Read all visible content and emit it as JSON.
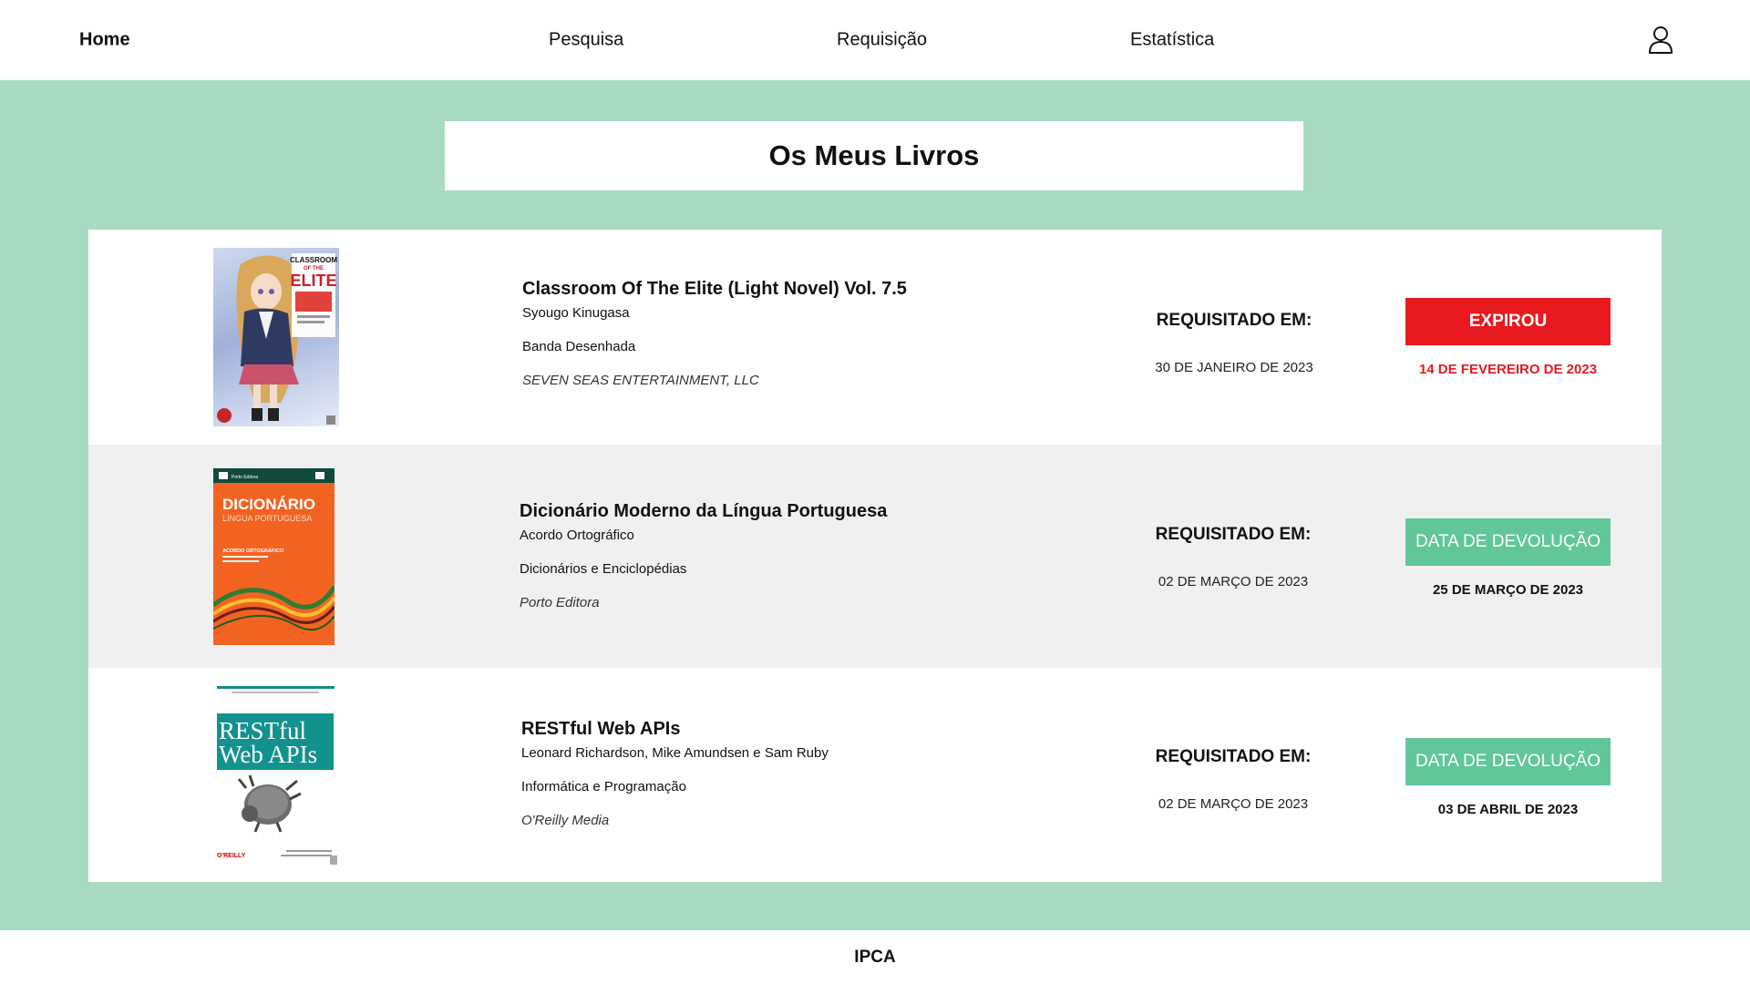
{
  "nav": {
    "home": "Home",
    "pesquisa": "Pesquisa",
    "requisicao": "Requisição",
    "estatistica": "Estatística",
    "user_icon": "user-icon"
  },
  "page": {
    "title": "Os Meus Livros"
  },
  "books": [
    {
      "title": "Classroom Of The Elite (Light Novel) Vol. 7.5",
      "author": "Syougo Kinugasa",
      "category": "Banda Desenhada",
      "publisher": "SEVEN SEAS ENTERTAINMENT, LLC",
      "requested_label": "REQUISITADO EM:",
      "requested_date": "30 DE JANEIRO DE 2023",
      "status_label": "EXPIROU",
      "status_date": "14 DE FEVEREIRO DE 2023",
      "cover": {
        "top_text": "CLASSROOM",
        "top_text2": "OF THE",
        "main_text": "ELITE"
      }
    },
    {
      "title": "Dicionário Moderno da Língua Portuguesa",
      "author": "Acordo Ortográfico",
      "category": "Dicionários e Enciclopédias",
      "publisher": "Porto Editora",
      "requested_label": "REQUISITADO EM:",
      "requested_date": "02 DE MARÇO DE 2023",
      "status_label": "DATA DE DEVOLUÇÃO",
      "status_date": "25 DE MARÇO DE 2023",
      "cover": {
        "main_text": "DICIONÁRIO",
        "sub_text": "LÍNGUA PORTUGUESA",
        "brand": "Porto Editora",
        "small": "ACORDO ORTOGRÁFICO"
      }
    },
    {
      "title": "RESTful Web APIs",
      "author": "Leonard Richardson, Mike Amundsen e Sam Ruby",
      "category": "Informática e Programação",
      "publisher": "O'Reilly Media",
      "requested_label": "REQUISITADO EM:",
      "requested_date": "02 DE MARÇO DE 2023",
      "status_label": "DATA DE DEVOLUÇÃO",
      "status_date": "03 DE ABRIL DE 2023",
      "cover": {
        "line1": "RESTful",
        "line2": "Web APIs",
        "brand": "O'REILLY"
      }
    }
  ],
  "footer": {
    "text": "IPCA"
  },
  "colors": {
    "background": "#a9dbc2",
    "expired": "#e8191f",
    "due": "#61c799"
  }
}
